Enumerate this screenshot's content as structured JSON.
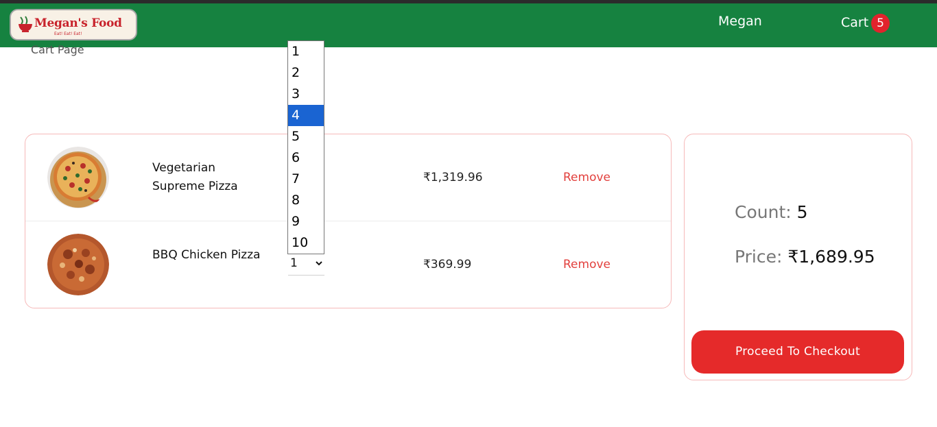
{
  "header": {
    "logo": {
      "name": "Megan's Food",
      "tagline": "Eat! Eat! Eat!"
    },
    "user": "Megan",
    "cart_label": "Cart",
    "cart_count": "5",
    "background_color": "#168240"
  },
  "page_label": "Cart Page",
  "cart_items": [
    {
      "name": "Vegetarian Supreme Pizza",
      "price": "₹1,319.96",
      "remove_label": "Remove",
      "image": "vegetarian-pizza"
    },
    {
      "name": "BBQ Chicken Pizza",
      "price": "₹369.99",
      "remove_label": "Remove",
      "image": "bbq-chicken-pizza",
      "quantity": "1"
    }
  ],
  "quantity_dropdown": {
    "options": [
      "1",
      "2",
      "3",
      "4",
      "5",
      "6",
      "7",
      "8",
      "9",
      "10"
    ],
    "highlighted": "4"
  },
  "summary": {
    "count_label": "Count:",
    "count_value": "5",
    "price_label": "Price:",
    "price_value": "₹1,689.95",
    "checkout_label": "Proceed To Checkout"
  },
  "colors": {
    "accent": "#e52a2a",
    "remove": "#e2403d",
    "panel_border": "#f6b9b9",
    "dropdown_highlight": "#1a64d2"
  }
}
